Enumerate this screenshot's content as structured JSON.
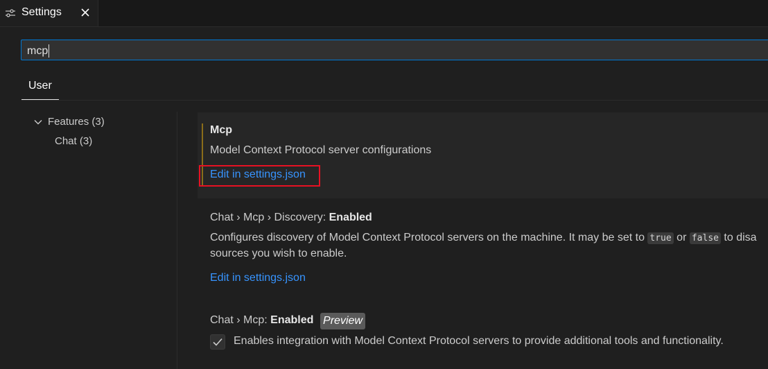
{
  "tab": {
    "icon": "settings-sliders-icon",
    "title": "Settings",
    "close_icon": "close-icon"
  },
  "search": {
    "value": "mcp"
  },
  "scope_tabs": [
    {
      "label": "User"
    }
  ],
  "toc": {
    "items": [
      {
        "label": "Features (3)",
        "expanded": true
      },
      {
        "label": "Chat (3)"
      }
    ]
  },
  "settings": [
    {
      "title_bold": "Mcp",
      "description": "Model Context Protocol server configurations",
      "link": "Edit in settings.json",
      "focused": true
    },
    {
      "category": "Chat › Mcp › Discovery: ",
      "name": "Enabled",
      "description_part1": "Configures discovery of Model Context Protocol servers on the machine. It may be set to ",
      "code_true": "true",
      "description_or": " or ",
      "code_false": "false",
      "description_part2": " to disa",
      "description_line2": "sources you wish to enable.",
      "link": "Edit in settings.json"
    },
    {
      "category": "Chat › Mcp: ",
      "name": "Enabled",
      "badge": "Preview",
      "checked": true,
      "checkbox_label": "Enables integration with Model Context Protocol servers to provide additional tools and functionality."
    }
  ],
  "colors": {
    "background": "#1f1f1f",
    "link": "#3794ff",
    "focus_border": "#0078d4",
    "highlight_box": "#e81123"
  }
}
